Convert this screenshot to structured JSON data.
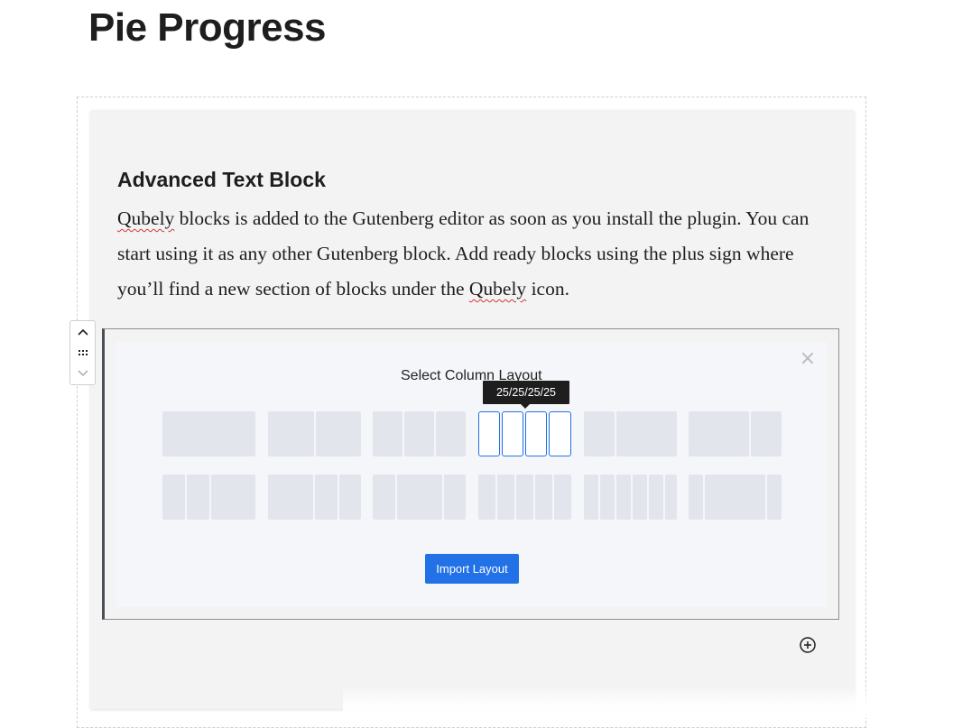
{
  "page": {
    "title": "Pie Progress"
  },
  "text_block": {
    "heading": "Advanced Text Block",
    "paragraph_parts": [
      "Qubely",
      " blocks is added to the Gutenberg editor as soon as you install the plugin. You can start using it as any other Gutenberg block. Add ready blocks using the plus sign where you’ll find a new section of blocks under the ",
      "Qubely",
      " icon."
    ]
  },
  "block_mover": {
    "up_icon": "chevron-up-icon",
    "drag_icon": "drag-handle-icon",
    "down_icon": "chevron-down-icon"
  },
  "column_picker": {
    "title": "Select Column Layout",
    "close_icon": "×",
    "tooltip": "25/25/25/25",
    "active_layout": "25/25/25/25",
    "layouts_row1": [
      "100",
      "50/50",
      "33/33/33",
      "25/25/25/25",
      "33/66",
      "66/33"
    ],
    "layouts_row2": [
      "25/25/50",
      "50/25/25",
      "25/50/25",
      "20/20/20/20/20",
      "16/16/16/16/16/16",
      "16/66/16"
    ],
    "import_label": "Import Layout"
  },
  "add_block_icon": "plus-circle-icon",
  "colors": {
    "accent": "#2271e6",
    "tooltip_bg": "#1e1e1e",
    "cell": "#e3e5ec"
  }
}
